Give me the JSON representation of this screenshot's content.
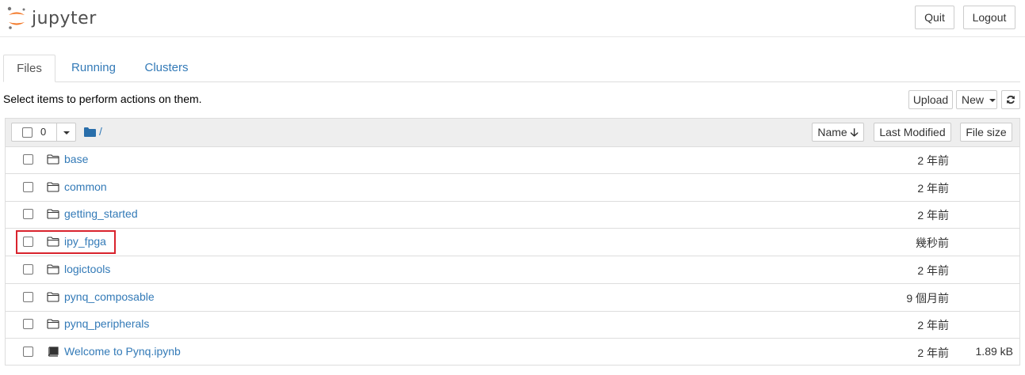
{
  "header": {
    "logo_text": "jupyter",
    "quit_label": "Quit",
    "logout_label": "Logout"
  },
  "tabs": [
    {
      "label": "Files"
    },
    {
      "label": "Running"
    },
    {
      "label": "Clusters"
    }
  ],
  "toolbar": {
    "instruction": "Select items to perform actions on them.",
    "upload_label": "Upload",
    "new_label": "New"
  },
  "list_header": {
    "selected_count": "0",
    "path": "/",
    "sort_name_label": "Name",
    "last_modified_label": "Last Modified",
    "file_size_label": "File size"
  },
  "items": [
    {
      "name": "base",
      "type": "folder",
      "modified": "2 年前",
      "size": ""
    },
    {
      "name": "common",
      "type": "folder",
      "modified": "2 年前",
      "size": ""
    },
    {
      "name": "getting_started",
      "type": "folder",
      "modified": "2 年前",
      "size": ""
    },
    {
      "name": "ipy_fpga",
      "type": "folder",
      "modified": "幾秒前",
      "size": ""
    },
    {
      "name": "logictools",
      "type": "folder",
      "modified": "2 年前",
      "size": ""
    },
    {
      "name": "pynq_composable",
      "type": "folder",
      "modified": "9 個月前",
      "size": ""
    },
    {
      "name": "pynq_peripherals",
      "type": "folder",
      "modified": "2 年前",
      "size": ""
    },
    {
      "name": "Welcome to Pynq.ipynb",
      "type": "notebook",
      "modified": "2 年前",
      "size": "1.89 kB"
    }
  ],
  "colors": {
    "link": "#337ab7",
    "logo_orange": "#f37726",
    "highlight": "#d9232d",
    "folder_blue": "#296eaa"
  },
  "icons": {
    "folder": "folder-open-icon",
    "notebook": "book-icon",
    "refresh": "refresh-icon"
  }
}
